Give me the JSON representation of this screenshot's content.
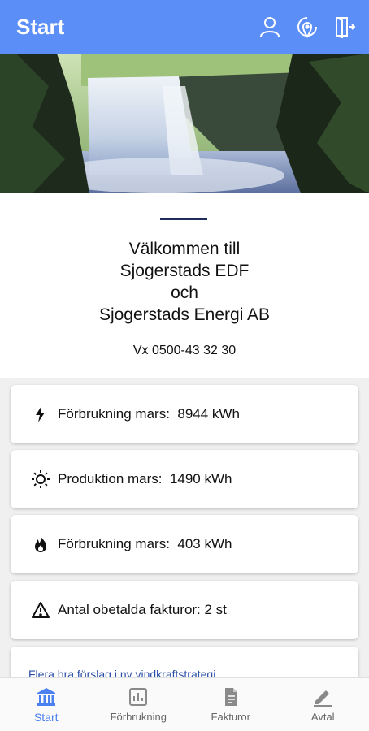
{
  "appbar": {
    "title": "Start",
    "actions": [
      {
        "icon": "person-icon"
      },
      {
        "icon": "location-icon"
      },
      {
        "icon": "logout-icon"
      }
    ]
  },
  "welcome": {
    "title_lines": [
      "Välkommen till",
      "Sjogerstads EDF",
      "och",
      "Sjogerstads Energi AB"
    ],
    "phone": "Vx 0500-43 32 30"
  },
  "cards": [
    {
      "icon": "bolt-icon",
      "text": "Förbrukning mars:  8944 kWh"
    },
    {
      "icon": "sun-icon",
      "text": "Produktion mars:  1490 kWh"
    },
    {
      "icon": "flame-icon",
      "text": "Förbrukning mars:  403 kWh"
    },
    {
      "icon": "warning-icon",
      "text": "Antal obetalda fakturor: 2 st"
    }
  ],
  "news_link": "Flera bra förslag i ny vindkraftstrategi",
  "bottom_nav": [
    {
      "label": "Start",
      "icon": "bank-icon",
      "active": true
    },
    {
      "label": "Förbrukning",
      "icon": "chart-icon",
      "active": false
    },
    {
      "label": "Fakturor",
      "icon": "document-icon",
      "active": false
    },
    {
      "label": "Avtal",
      "icon": "pen-icon",
      "active": false
    }
  ],
  "colors": {
    "appbar": "#5b8ef7",
    "active_nav": "#4a80f0",
    "link": "#2a4fa8",
    "rule": "#1f2d5c"
  }
}
